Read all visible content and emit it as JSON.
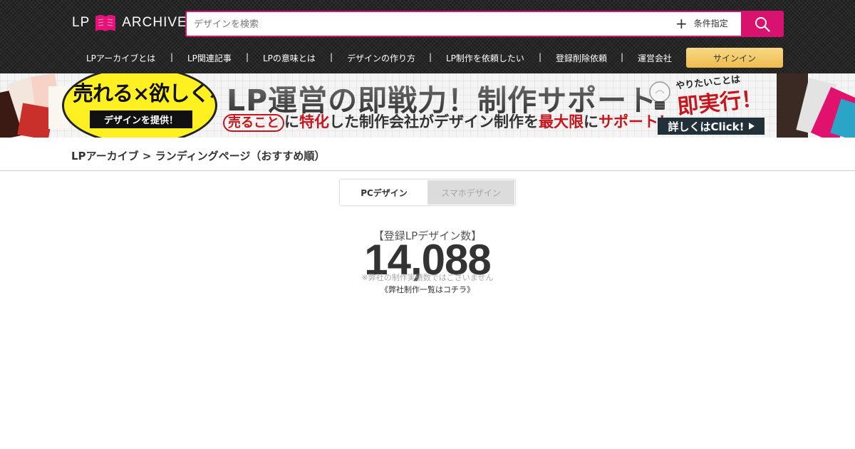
{
  "header": {
    "logo": {
      "left": "LP",
      "right": "ARCHIVE"
    },
    "search": {
      "placeholder": "デザインを検索",
      "filter_label": "条件指定"
    },
    "nav": [
      {
        "label": "LPアーカイブとは"
      },
      {
        "label": "LP関連記事"
      },
      {
        "label": "LPの意味とは"
      },
      {
        "label": "デザインの作り方"
      },
      {
        "label": "LP制作を依頼したい"
      },
      {
        "label": "登録削除依頼"
      },
      {
        "label": "運営会社"
      }
    ],
    "nav_separator": "|",
    "signin_label": "サインイン"
  },
  "banner": {
    "badge_title": "売れる×欲しくなる",
    "badge_sub": "デザインを提供！",
    "headline": "LP運営の即戦力！制作サポート",
    "tagline": {
      "highlight": "売ること",
      "p1": "に",
      "p2": "特化",
      "p3": "した制作会社がデザイン制作を",
      "p4": "最大限",
      "p5": "に",
      "p6": "サポート！"
    },
    "corner_top": "やりたいことは",
    "corner_main": "即実行！",
    "cta": "詳しくはClick!"
  },
  "breadcrumb": {
    "home": "LPアーカイブ",
    "sep": ">",
    "current": "ランディングページ（おすすめ順）"
  },
  "tabs": {
    "pc": "PCデザイン",
    "sp": "スマホデザイン",
    "active": "pc"
  },
  "stats": {
    "label": "【登録LPデザイン数】",
    "count": "14,088",
    "note": "※弊社の制作実績数ではございません",
    "link": "《弊社制作一覧はコチラ》"
  },
  "colors": {
    "accent": "#d8126f",
    "signin": "#f0c65a",
    "banner_red": "#c4161c",
    "badge_yellow": "#fff022"
  }
}
